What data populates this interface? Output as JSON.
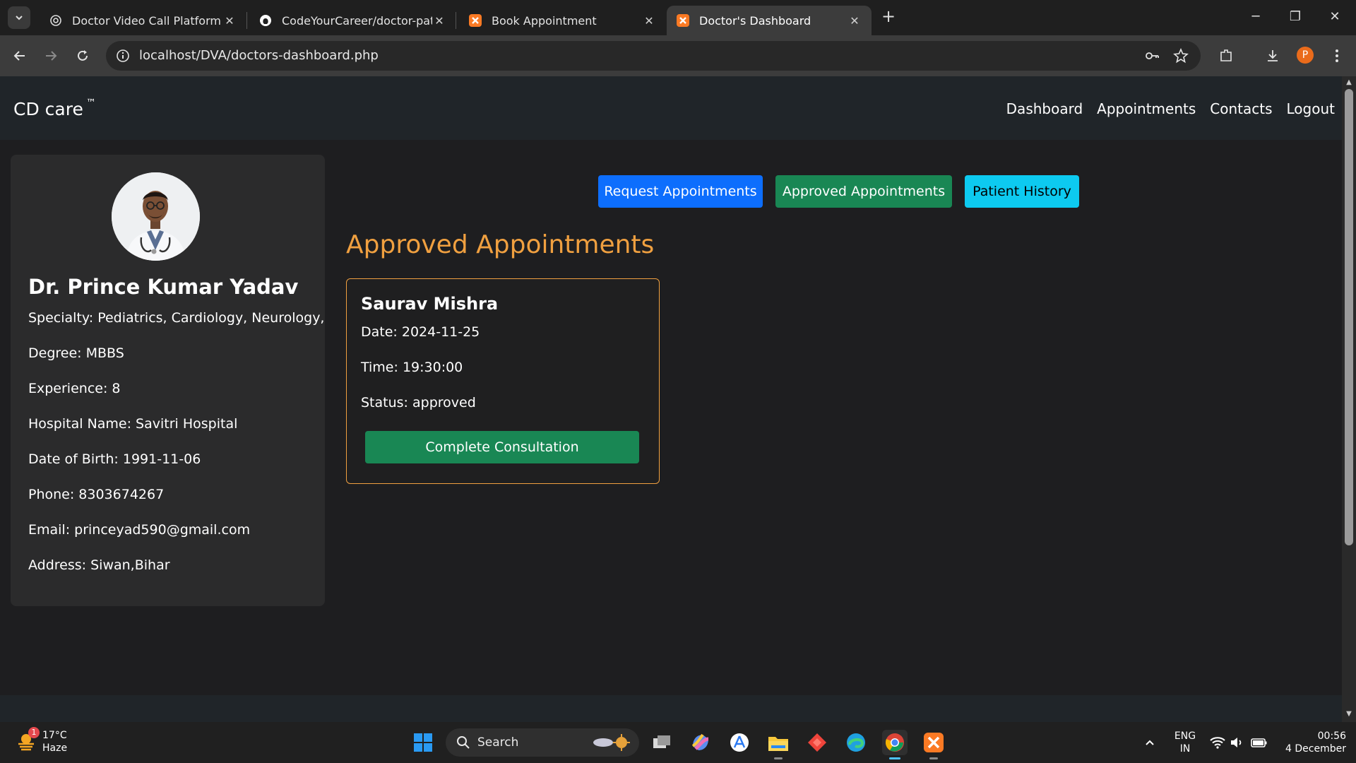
{
  "browser": {
    "tabs": [
      {
        "title": "Doctor Video Call Platform",
        "icon": "openai-icon",
        "active": false
      },
      {
        "title": "CodeYourCareer/doctor-patient",
        "icon": "github-icon",
        "active": false
      },
      {
        "title": "Book Appointment",
        "icon": "xampp-icon",
        "active": false
      },
      {
        "title": "Doctor's Dashboard",
        "icon": "xampp-icon",
        "active": true
      }
    ],
    "url": "localhost/DVA/doctors-dashboard.php",
    "profile_initial": "P"
  },
  "site": {
    "brand": "CD care",
    "brand_mark": "™",
    "nav": [
      "Dashboard",
      "Appointments",
      "Contacts",
      "Logout"
    ]
  },
  "doctor": {
    "name": "Dr. Prince Kumar Yadav",
    "specialty": "Specialty: Pediatrics, Cardiology, Neurology,",
    "degree": "Degree: MBBS",
    "experience": "Experience: 8",
    "hospital": "Hospital Name: Savitri Hospital",
    "dob": "Date of Birth: 1991-11-06",
    "phone": "Phone: 8303674267",
    "email": "Email: princeyad590@gmail.com",
    "address": "Address: Siwan,Bihar"
  },
  "actions": {
    "request": "Request Appointments",
    "approved": "Approved Appointments",
    "history": "Patient History"
  },
  "section_title": "Approved Appointments",
  "appointment": {
    "patient": "Saurav Mishra",
    "date": "Date: 2024-11-25",
    "time": "Time: 19:30:00",
    "status": "Status: approved",
    "button": "Complete Consultation"
  },
  "taskbar": {
    "weather_temp": "17°C",
    "weather_desc": "Haze",
    "weather_badge": "1",
    "search_label": "Search",
    "lang_top": "ENG",
    "lang_bottom": "IN",
    "clock_time": "00:56",
    "clock_date": "4 December"
  },
  "colors": {
    "accent_orange": "#f0a040",
    "btn_blue": "#0d6efd",
    "btn_green": "#198754",
    "btn_cyan": "#0dcaf0"
  }
}
